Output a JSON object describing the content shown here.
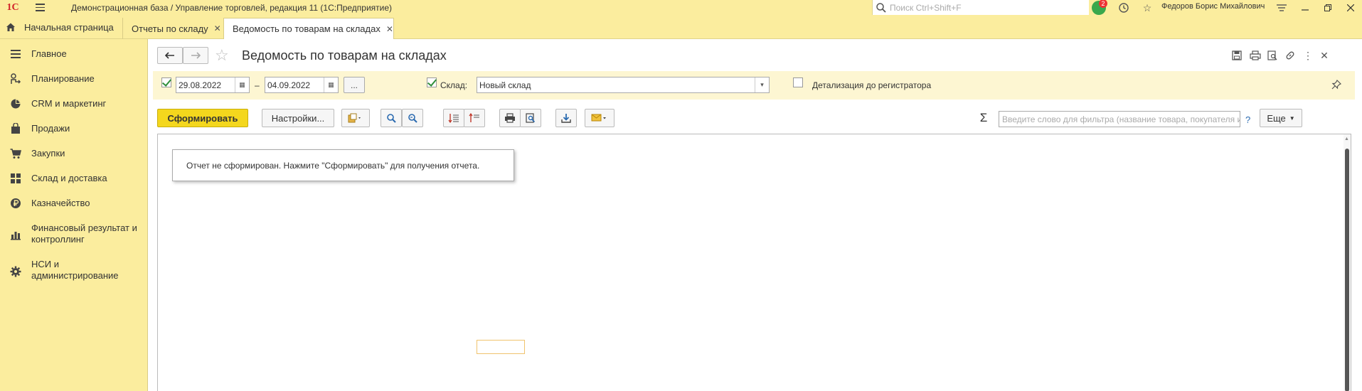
{
  "window": {
    "title": "Демонстрационная база / Управление торговлей, редакция 11  (1С:Предприятие)",
    "search_placeholder": "Поиск Ctrl+Shift+F",
    "notification_count": "2",
    "user_name": "Федоров Борис Михайлович"
  },
  "tabs": {
    "home": "Начальная страница",
    "items": [
      {
        "label": "Отчеты по складу"
      },
      {
        "label": "Ведомость по товарам на складах"
      }
    ]
  },
  "sidebar": {
    "items": [
      {
        "label": "Главное",
        "icon": "menu-icon"
      },
      {
        "label": "Планирование",
        "icon": "planning-icon"
      },
      {
        "label": "CRM и маркетинг",
        "icon": "pie-chart-icon"
      },
      {
        "label": "Продажи",
        "icon": "bag-icon"
      },
      {
        "label": "Закупки",
        "icon": "cart-icon"
      },
      {
        "label": "Склад и доставка",
        "icon": "warehouse-icon"
      },
      {
        "label": "Казначейство",
        "icon": "ruble-icon"
      },
      {
        "label": "Финансовый результат и",
        "label2": "контроллинг",
        "icon": "bar-chart-icon"
      },
      {
        "label": "НСИ и",
        "label2": "администрирование",
        "icon": "gear-icon"
      }
    ]
  },
  "page": {
    "title": "Ведомость по товарам на складах"
  },
  "params": {
    "date_from": "29.08.2022",
    "date_dash": "–",
    "date_to": "04.09.2022",
    "period_button": "...",
    "warehouse_label": "Склад:",
    "warehouse_value": "Новый склад",
    "detail_label": "Детализация до регистратора",
    "period_checked": true,
    "warehouse_checked": true,
    "detail_checked": false
  },
  "toolbar": {
    "generate": "Сформировать",
    "settings": "Настройки...",
    "sigma": "Σ",
    "filter_placeholder": "Введите слово для фильтра (название товара, покупателя и пр.)",
    "help": "?",
    "more": "Еще"
  },
  "report": {
    "message": "Отчет не сформирован. Нажмите \"Сформировать\" для получения отчета."
  }
}
